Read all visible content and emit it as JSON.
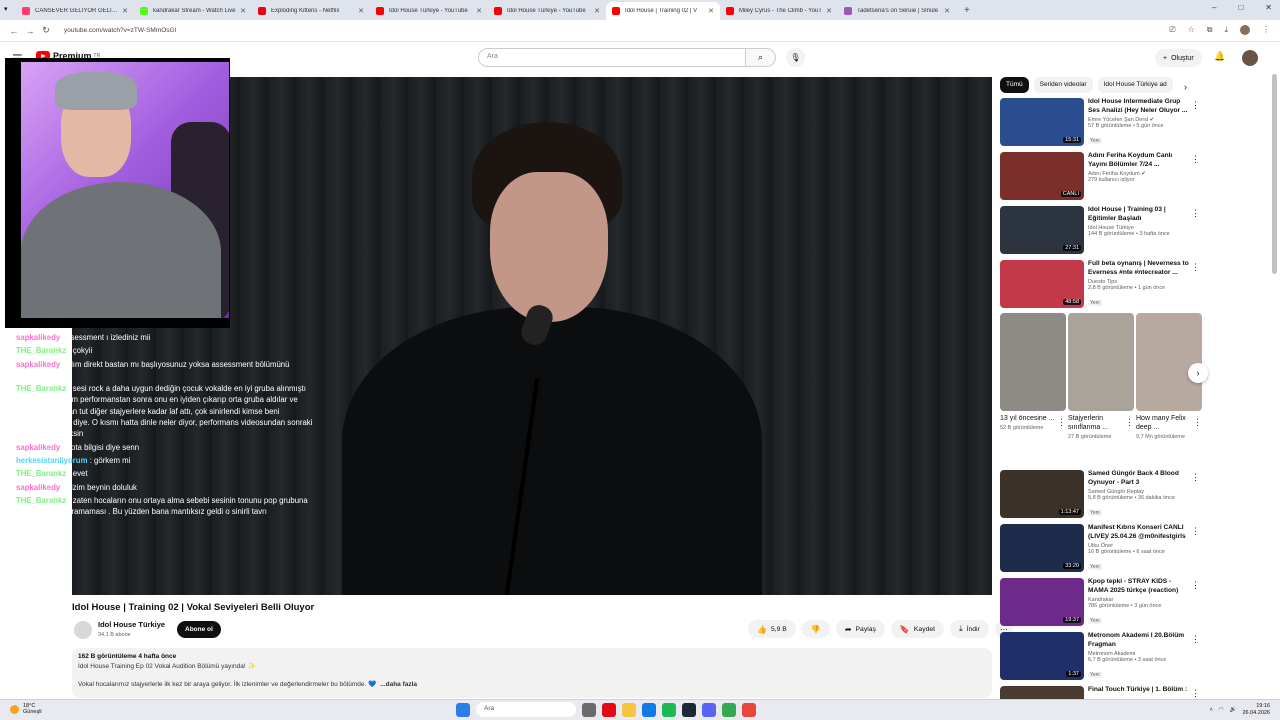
{
  "browser": {
    "tabs": [
      {
        "title": "CANSEVER GELİYOR GELİYOR K",
        "color": "#ff3c6e"
      },
      {
        "title": "kandrakar Stream - Watch Live",
        "color": "#53fc18"
      },
      {
        "title": "Exploding Kittens - Netflix",
        "color": "#e50914"
      },
      {
        "title": "Idol House Türkiye - YouTube",
        "color": "#ff0000"
      },
      {
        "title": "Idol House Türkiye - YouTube",
        "color": "#ff0000"
      },
      {
        "title": "Idol House | Training 02 | V",
        "color": "#ff0000",
        "active": true
      },
      {
        "title": "Miley Cyrus - The Climb - YouT",
        "color": "#ff0000"
      },
      {
        "title": "Tadetsena's on Seruie | Smule",
        "color": "#9b59b6"
      }
    ],
    "new_tab": "+",
    "url": "youtube.com/watch?v=zTW-SMmOsGI",
    "window_controls": [
      "–",
      "□",
      "✕"
    ]
  },
  "youtube": {
    "logo_text": "Premium",
    "logo_sup": "TR",
    "search_placeholder": "Ara",
    "create_label": "Oluştur"
  },
  "video": {
    "title": "Idol House | Training 02 | Vokal Seviyeleri Belli Oluyor",
    "channel": "Idol House Türkiye",
    "subscribers": "34,1 B abone",
    "subscribe_label": "Abone ol",
    "likes": "5,9 B",
    "share_label": "Paylaş",
    "save_label": "Kaydet",
    "download_label": "İndir",
    "views_age": "162 B görüntüleme  4 hafta önce",
    "desc_line1": "Idol House Training Ep 02 Vokal Audition Bölümü yayında! ✨",
    "desc_line2": "Vokal hocalarımız stajyerlerle ilk kez bir araya geliyor. İlk izlenimler ve değerlendirmeler bu bölümde. 💙",
    "more_label": "...daha fazla"
  },
  "chat": [
    {
      "user": "sapkalikedy",
      "color": "pink",
      "text": "assessment ı izlediniz mii"
    },
    {
      "user": "THE_Barankz",
      "color": "green",
      "text": ": çokyii"
    },
    {
      "user": "sapkalikedy",
      "color": "pink",
      "text": "balım direkt bastan mı başlıyosunuz yoksa assessment bölümünü izlediniz mii"
    },
    {
      "user": "THE_Barankz",
      "color": "green",
      "text": ": sesi rock a daha uygun dediğin çocuk vokalde en iyi gruba alınmıştı ama geçen bölüm performanstan sonra onu en iyiden çıkarıp orta gruba aldılar ve çocuk hocalardan tut diğer stajyerlere kadar laf attı, çok sinirlendi kimse beni çıkaramaz falan diye. O kısmı hatta dinle neler diyor, performans videosundan sonraki videoda göreceksin"
    },
    {
      "user": "sapkalikedy",
      "color": "pink",
      "text": ": nota bilgisi diye senn"
    },
    {
      "user": "herkesistanliyorum",
      "color": "cyan",
      "text": ": görkem mi"
    },
    {
      "user": "THE_Barankz",
      "color": "green",
      "text": ": evet"
    },
    {
      "user": "sapkalikedy",
      "color": "pink",
      "text": ": bizim beynin doluluk"
    },
    {
      "user": "THE_Barankz",
      "color": "green",
      "text": ": zaten hocaların onu ortaya alma sebebi sesinin tonunu pop grubuna diğerlerine uyduramaması . Bu yüzden bana mantıksız geldi o sinirli tavrı"
    }
  ],
  "sidebar": {
    "chips": [
      "Tümü",
      "Seriden videolar",
      "Idol House Türkiye ad"
    ],
    "recs_top": [
      {
        "title": "Idol House Intermediate Grup Ses Analizi (Hey Neler Oluyor ...",
        "channel": "Emre Yücelen Şan Dersi ✔",
        "views": "57 B görüntüleme • 5 gün önce",
        "badge": "Yeni",
        "duration": "15:31",
        "thumb": "#2a4d8f"
      },
      {
        "title": "Adını Feriha Koydum Canlı Yayını Bölümler 7/24 ...",
        "channel": "Adını Feriha Koydum ✔",
        "views": "279 kullanıcı izliyor",
        "badge": "",
        "duration": "CANLI",
        "thumb": "#7a2f2a"
      },
      {
        "title": "Idol House | Training 03 | Eğitimler Başladı",
        "channel": "Idol House Türkiye",
        "views": "144 B görüntüleme • 3 hafta önce",
        "badge": "",
        "duration": "27:31",
        "thumb": "#2c3440"
      },
      {
        "title": "Full beta oynanış | Neverness to Everness #nte #ntecreator ...",
        "channel": "Duesto Tips",
        "views": "2,8 B görüntüleme • 1 gün önce",
        "badge": "Yeni",
        "duration": "48:58",
        "thumb": "#c23a4a"
      }
    ],
    "shorts": [
      {
        "title": "13 yıl öncesine ...",
        "views": "52 B görüntüleme",
        "thumb": "#8e8a86"
      },
      {
        "title": "Stajyerlerin sınıflanma ...",
        "views": "27 B görüntüleme",
        "thumb": "#a9a39a"
      },
      {
        "title": "How many Felix deep ...",
        "views": "9,7 Mn görüntüleme",
        "thumb": "#b7a9a0"
      }
    ],
    "recs_bottom": [
      {
        "title": "Samed Güngör Back 4 Blood Oynuyor - Part 3",
        "channel": "Samed Güngör Replay",
        "views": "5,8 B görüntüleme • 36 dakika önce",
        "badge": "Yeni",
        "duration": "1:13:47",
        "thumb": "#3b3128"
      },
      {
        "title": "Manifest Kıbrıs Konseri CANLI (LIVE)/ 25.04.26 @m0nifestgirls",
        "channel": "Utku Öner",
        "views": "16 B görüntüleme • 6 saat önce",
        "badge": "Yeni",
        "duration": "33:20",
        "thumb": "#1c2c4a"
      },
      {
        "title": "Kpop tepki - STRAY KIDS - MAMA 2025 türkçe (reaction)",
        "channel": "Kandrakar",
        "views": "786 görüntüleme • 3 gün önce",
        "badge": "Yeni",
        "duration": "19:37",
        "thumb": "#6d2a8a"
      },
      {
        "title": "Metronom Akademi I 20.Bölüm Fragman",
        "channel": "Metronom Akademi",
        "views": "6,7 B görüntüleme • 3 saat önce",
        "badge": "Yeni",
        "duration": "1:37",
        "thumb": "#1f2f6a"
      },
      {
        "title": "Final Touch Türkiye | 1. Bölüm :",
        "channel": "",
        "views": "",
        "badge": "",
        "duration": "",
        "thumb": "#4a3b30"
      }
    ]
  },
  "taskbar": {
    "temp": "18°C",
    "weather": "Güneşli",
    "search": "Ara",
    "time": "19:16",
    "date": "26.04.2026"
  }
}
